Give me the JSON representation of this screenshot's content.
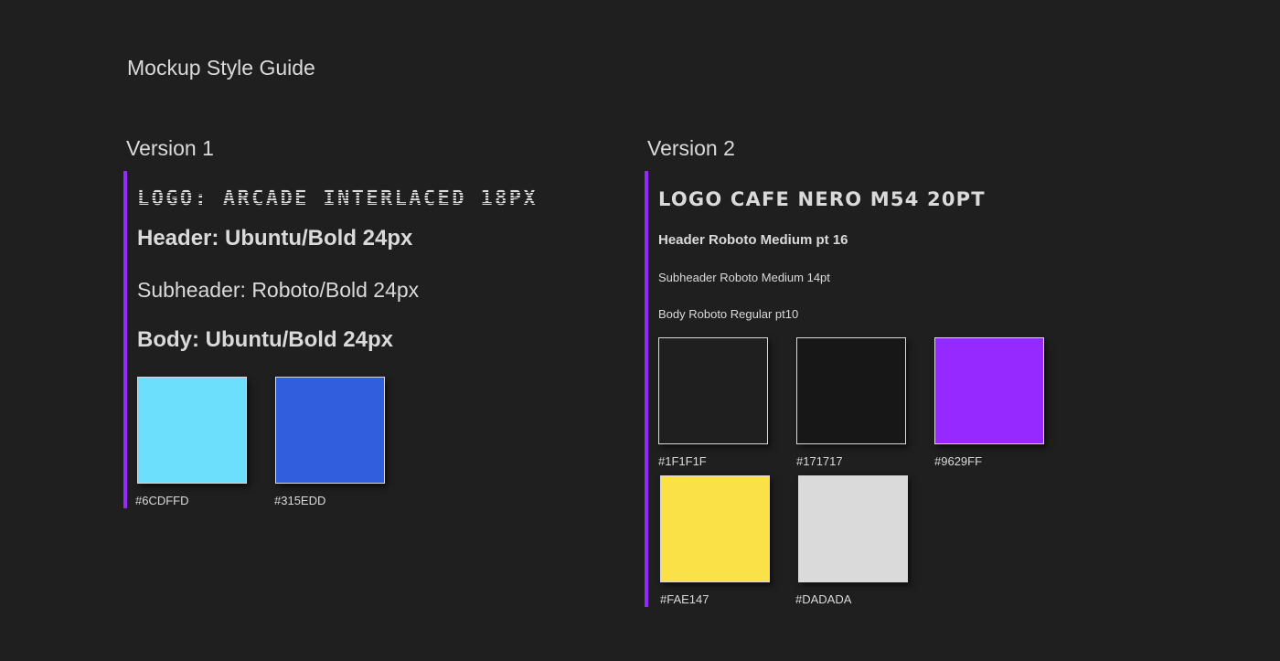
{
  "page_title": "Mockup Style Guide",
  "version1": {
    "title": "Version 1",
    "logo": "Logo: Arcade Interlaced 18px",
    "header": "Header: Ubuntu/Bold 24px",
    "subheader": "Subheader: Roboto/Bold 24px",
    "body": "Body: Ubuntu/Bold 24px",
    "swatches": [
      {
        "label": "#6CDFFD",
        "color": "#6CDFFD"
      },
      {
        "label": "#315EDD",
        "color": "#315EDD"
      }
    ]
  },
  "version2": {
    "title": "Version 2",
    "logo": "Logo Cafe Nero M54 20pt",
    "header": "Header Roboto Medium pt 16",
    "subheader": "Subheader Roboto Medium 14pt",
    "body": "Body Roboto Regular pt10",
    "swatches": [
      {
        "label": "#1F1F1F",
        "color": "#1F1F1F"
      },
      {
        "label": "#171717",
        "color": "#171717"
      },
      {
        "label": "#9629FF",
        "color": "#9629FF"
      },
      {
        "label": "#FAE147",
        "color": "#FAE147"
      },
      {
        "label": "#DADADA",
        "color": "#DADADA"
      }
    ]
  },
  "colors": {
    "background": "#1F1F1F",
    "accent": "#9629FF",
    "text": "#DADADA"
  }
}
